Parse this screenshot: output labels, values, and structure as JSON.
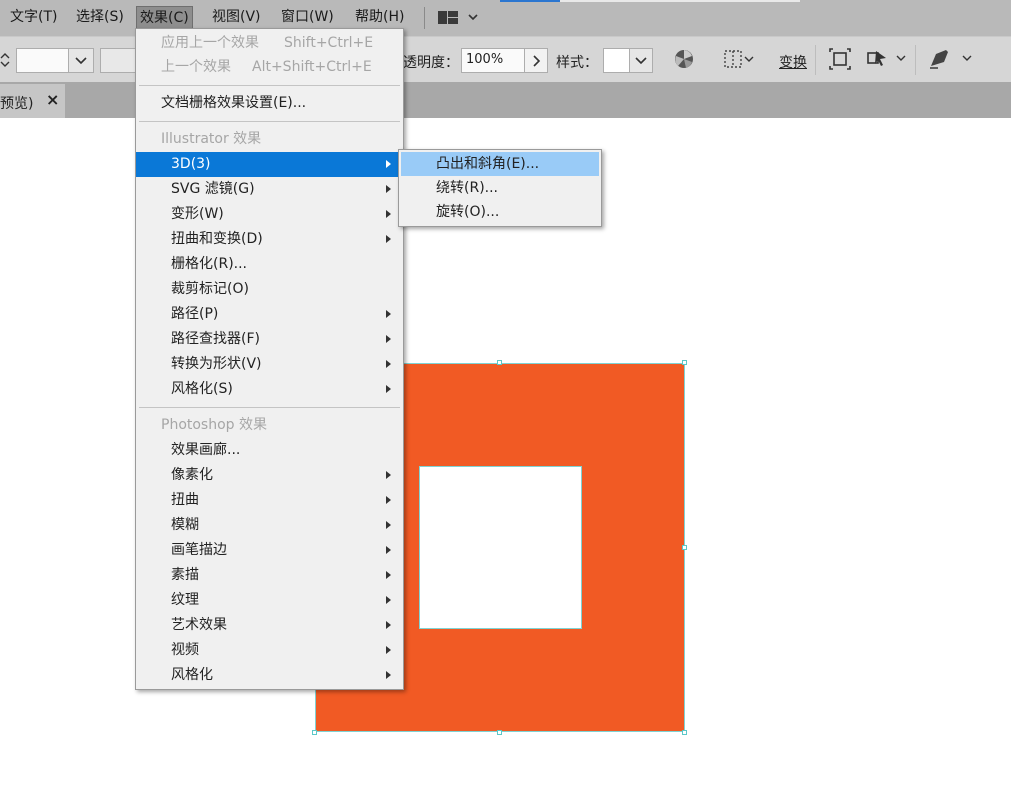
{
  "menubar": {
    "items": [
      {
        "label": "文字(T)"
      },
      {
        "label": "选择(S)"
      },
      {
        "label": "效果(C)"
      },
      {
        "label": "视图(V)"
      },
      {
        "label": "窗口(W)"
      },
      {
        "label": "帮助(H)"
      }
    ],
    "workspace_icon": "layout-grid-icon"
  },
  "controlbar": {
    "opacity_label": "透明度：",
    "opacity_value": "100%",
    "style_label": "样式：",
    "transform_label": "变换"
  },
  "tab": {
    "title": "预览)",
    "close": "×"
  },
  "effect_menu": {
    "apply_last": {
      "label": "应用上一个效果",
      "shortcut": "Shift+Ctrl+E"
    },
    "last": {
      "label": "上一个效果",
      "shortcut": "Alt+Shift+Ctrl+E"
    },
    "raster_settings": "文档栅格效果设置(E)...",
    "illustrator_header": "Illustrator 效果",
    "illustrator_items": [
      {
        "label": "3D(3)",
        "submenu": true
      },
      {
        "label": "SVG 滤镜(G)",
        "submenu": true
      },
      {
        "label": "变形(W)",
        "submenu": true
      },
      {
        "label": "扭曲和变换(D)",
        "submenu": true
      },
      {
        "label": "栅格化(R)...",
        "submenu": false
      },
      {
        "label": "裁剪标记(O)",
        "submenu": false
      },
      {
        "label": "路径(P)",
        "submenu": true
      },
      {
        "label": "路径查找器(F)",
        "submenu": true
      },
      {
        "label": "转换为形状(V)",
        "submenu": true
      },
      {
        "label": "风格化(S)",
        "submenu": true
      }
    ],
    "photoshop_header": "Photoshop 效果",
    "photoshop_items": [
      {
        "label": "效果画廊...",
        "submenu": false
      },
      {
        "label": "像素化",
        "submenu": true
      },
      {
        "label": "扭曲",
        "submenu": true
      },
      {
        "label": "模糊",
        "submenu": true
      },
      {
        "label": "画笔描边",
        "submenu": true
      },
      {
        "label": "素描",
        "submenu": true
      },
      {
        "label": "纹理",
        "submenu": true
      },
      {
        "label": "艺术效果",
        "submenu": true
      },
      {
        "label": "视频",
        "submenu": true
      },
      {
        "label": "风格化",
        "submenu": true
      }
    ]
  },
  "submenu_3d": {
    "items": [
      "凸出和斜角(E)...",
      "绕转(R)...",
      "旋转(O)..."
    ]
  },
  "colors": {
    "artwork_fill": "#f15a24",
    "menu_highlight": "#0a78d7",
    "submenu_highlight": "#99cbf7",
    "selection": "#7fd3d3"
  }
}
